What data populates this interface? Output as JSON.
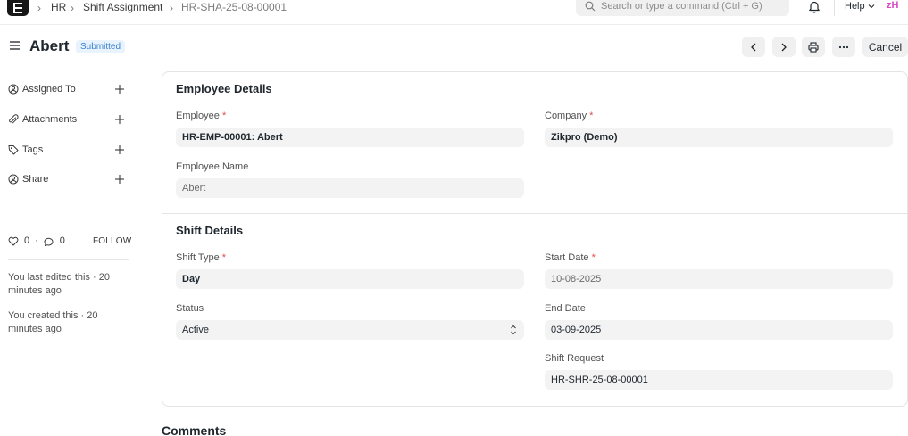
{
  "navbar": {
    "logo_letter": "E",
    "breadcrumbs": [
      "HR",
      "Shift Assignment",
      "HR-SHA-25-08-00001"
    ],
    "search_placeholder": "Search or type a command (Ctrl + G)",
    "help_label": "Help",
    "avatar_initials": "zH"
  },
  "page": {
    "title": "Abert",
    "status_badge": "Submitted",
    "cancel_label": "Cancel"
  },
  "sidebar": {
    "items": [
      {
        "label": "Assigned To",
        "icon": "user-check-icon"
      },
      {
        "label": "Attachments",
        "icon": "paperclip-icon"
      },
      {
        "label": "Tags",
        "icon": "tag-icon"
      },
      {
        "label": "Share",
        "icon": "share-icon"
      }
    ],
    "likes": "0",
    "comments": "0",
    "follow_label": "FOLLOW",
    "edited_note": "You last edited this · 20 minutes ago",
    "created_note": "You created this · 20 minutes ago"
  },
  "form": {
    "employee_details": {
      "title": "Employee Details",
      "employee_label": "Employee",
      "employee_value": "HR-EMP-00001: Abert",
      "company_label": "Company",
      "company_value": "Zikpro (Demo)",
      "employee_name_label": "Employee Name",
      "employee_name_value": "Abert"
    },
    "shift_details": {
      "title": "Shift Details",
      "shift_type_label": "Shift Type",
      "shift_type_value": "Day",
      "start_date_label": "Start Date",
      "start_date_value": "10-08-2025",
      "status_label": "Status",
      "status_value": "Active",
      "end_date_label": "End Date",
      "end_date_value": "03-09-2025",
      "shift_request_label": "Shift Request",
      "shift_request_value": "HR-SHR-25-08-00001"
    },
    "required_mark": "*"
  },
  "comments_title": "Comments",
  "colors": {
    "badge_bg": "#e8f3fd",
    "badge_text": "#3a7fd0",
    "required": "#e24c4c",
    "avatar": "#d948c8"
  }
}
